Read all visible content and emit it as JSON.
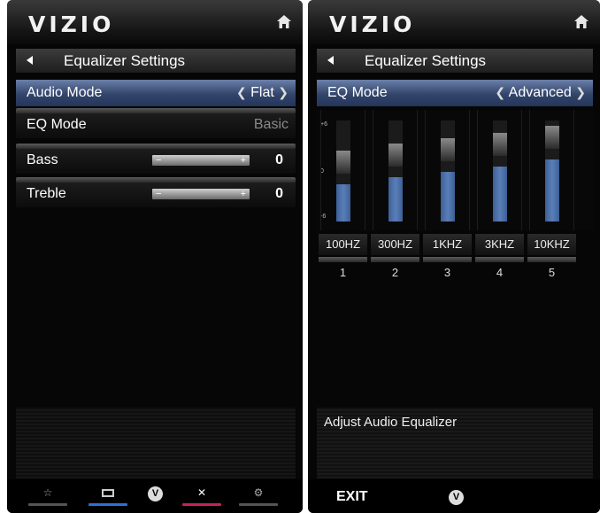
{
  "left": {
    "logo": "VIZIO",
    "title": "Equalizer Settings",
    "audio_mode": {
      "label": "Audio Mode",
      "value": "Flat"
    },
    "eq_mode": {
      "label": "EQ Mode",
      "value": "Basic"
    },
    "bass": {
      "label": "Bass",
      "value": "0",
      "level": 0.5
    },
    "treble": {
      "label": "Treble",
      "value": "0",
      "level": 0.5
    }
  },
  "right": {
    "logo": "VIZIO",
    "title": "Equalizer Settings",
    "eq_mode": {
      "label": "EQ Mode",
      "value": "Advanced"
    },
    "scale": {
      "top": "+6",
      "mid": "0",
      "bottom": "-6"
    },
    "bands": [
      {
        "freq": "100HZ",
        "index": "1",
        "gain": 0.0
      },
      {
        "freq": "300HZ",
        "index": "2",
        "gain": 1.5
      },
      {
        "freq": "1KHZ",
        "index": "3",
        "gain": 2.5
      },
      {
        "freq": "3KHZ",
        "index": "4",
        "gain": 3.5
      },
      {
        "freq": "10KHZ",
        "index": "5",
        "gain": 5.0
      }
    ],
    "description": "Adjust Audio Equalizer",
    "exit_label": "EXIT"
  },
  "icons": {
    "home": "home-icon",
    "star": "star-icon",
    "input": "input-icon",
    "vbutton": "v-button-icon",
    "close": "close-icon",
    "settings": "gear-icon"
  },
  "colors": {
    "selected_row": "#33456b",
    "eq_fill": "#5a7fb8",
    "input_line": "#2f6fd6",
    "close_line": "#c8225a"
  }
}
